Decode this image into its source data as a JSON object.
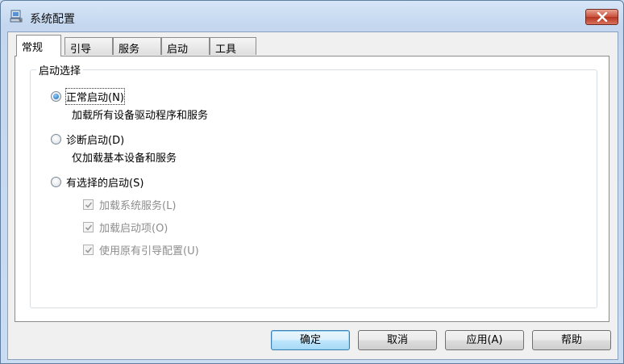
{
  "window": {
    "title": "系统配置",
    "icon": "msconfig-computer-icon",
    "close_icon": "close-icon"
  },
  "tabs": [
    {
      "label": "常规",
      "active": true
    },
    {
      "label": "引导",
      "active": false
    },
    {
      "label": "服务",
      "active": false
    },
    {
      "label": "启动",
      "active": false
    },
    {
      "label": "工具",
      "active": false
    }
  ],
  "startup_selection": {
    "legend": "启动选择",
    "options": [
      {
        "label": "正常启动(N)",
        "description": "加载所有设备驱动程序和服务",
        "checked": true
      },
      {
        "label": "诊断启动(D)",
        "description": "仅加载基本设备和服务",
        "checked": false
      },
      {
        "label": "有选择的启动(S)",
        "description": "",
        "checked": false
      }
    ],
    "selective_items": [
      {
        "label": "加载系统服务(L)",
        "checked": true,
        "enabled": false
      },
      {
        "label": "加载启动项(O)",
        "checked": true,
        "enabled": false
      },
      {
        "label": "使用原有引导配置(U)",
        "checked": true,
        "enabled": false
      }
    ]
  },
  "buttons": {
    "ok": "确定",
    "cancel": "取消",
    "apply": "应用(A)",
    "help": "帮助"
  },
  "colors": {
    "accent": "#3c7fb1",
    "close_red": "#c9503b"
  }
}
